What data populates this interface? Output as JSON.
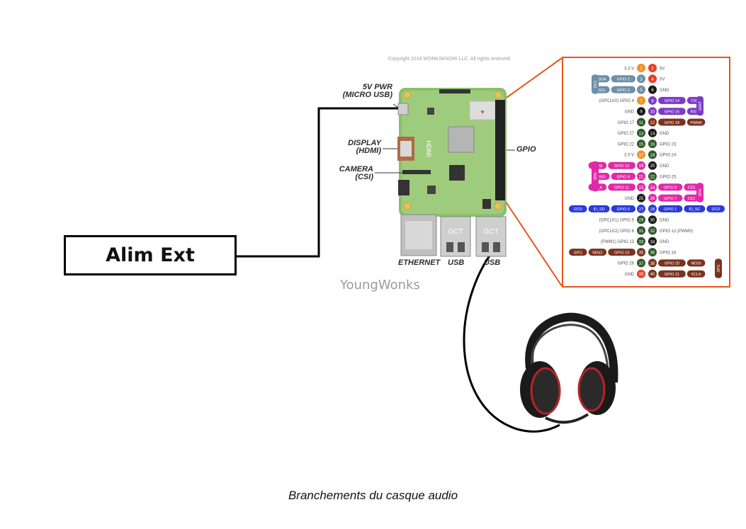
{
  "alim_label": "Alim Ext",
  "caption": "Branchements du casque audio",
  "copyright": "Copyright 2018 WONKSKNOW LLC. All rights reserved.",
  "brand": "YoungWonks",
  "board_labels": {
    "pwr_line1": "5V PWR",
    "pwr_line2": "(MICRO USB)",
    "display_line1": "DISPLAY",
    "display_line2": "(HDMI)",
    "camera_line1": "CAMERA",
    "camera_line2": "(CSI)",
    "gpio": "GPIO",
    "ethernet": "ETHERNET",
    "usb1": "USB",
    "usb2": "USB",
    "hdmi": "HDMI",
    "gct1": "GCT",
    "gct2": "GCT"
  },
  "pin_colors": {
    "power33": "#f0922a",
    "power5": "#e8402a",
    "ground": "#1a1a1a",
    "gpio": "#2f5a2a",
    "i2c": "#6d8fa8",
    "uart": "#7c3bc4",
    "spi": "#e02aa8",
    "pwm": "#7a3320",
    "id": "#2a3adc"
  },
  "pins": [
    {
      "pin_l": "1",
      "pin_r": "2",
      "left_label": "3.3 V",
      "right_label": "5V",
      "left_type": "power33",
      "right_type": "power5",
      "left_tags": [],
      "right_tags": []
    },
    {
      "pin_l": "3",
      "pin_r": "4",
      "left_label": "",
      "right_label": "5V",
      "left_type": "i2c",
      "right_type": "power5",
      "left_tags": [
        {
          "text": "SDA",
          "type": "i2c"
        },
        {
          "text": "GPIO 2",
          "type": "i2c"
        }
      ],
      "right_tags": []
    },
    {
      "pin_l": "5",
      "pin_r": "6",
      "left_label": "",
      "right_label": "GND",
      "left_type": "i2c",
      "right_type": "ground",
      "left_tags": [
        {
          "text": "SCL",
          "type": "i2c"
        },
        {
          "text": "GPIO 3",
          "type": "i2c"
        }
      ],
      "right_tags": []
    },
    {
      "pin_l": "7",
      "pin_r": "8",
      "left_label": "(GPCLK0) GPIO 4",
      "right_label": "",
      "left_type": "power33",
      "right_type": "uart",
      "left_tags": [],
      "right_tags": [
        {
          "text": "GPIO 14",
          "type": "uart"
        },
        {
          "text": "TXD",
          "type": "uart"
        }
      ]
    },
    {
      "pin_l": "9",
      "pin_r": "10",
      "left_label": "GND",
      "right_label": "",
      "left_type": "ground",
      "right_type": "uart",
      "left_tags": [],
      "right_tags": [
        {
          "text": "GPIO 15",
          "type": "uart"
        },
        {
          "text": "RXD",
          "type": "uart"
        }
      ]
    },
    {
      "pin_l": "11",
      "pin_r": "12",
      "left_label": "GPIO 17",
      "right_label": "",
      "left_type": "gpio",
      "right_type": "pwm",
      "left_tags": [],
      "right_tags": [
        {
          "text": "GPIO 18",
          "type": "pwm"
        },
        {
          "text": "PWM0",
          "type": "pwm"
        }
      ]
    },
    {
      "pin_l": "13",
      "pin_r": "14",
      "left_label": "GPIO 27",
      "right_label": "GND",
      "left_type": "gpio",
      "right_type": "ground",
      "left_tags": [],
      "right_tags": []
    },
    {
      "pin_l": "15",
      "pin_r": "16",
      "left_label": "GPIO 22",
      "right_label": "GPIO 23",
      "left_type": "gpio",
      "right_type": "gpio",
      "left_tags": [],
      "right_tags": []
    },
    {
      "pin_l": "17",
      "pin_r": "18",
      "left_label": "3.3 V",
      "right_label": "GPIO 24",
      "left_type": "power33",
      "right_type": "gpio",
      "left_tags": [],
      "right_tags": []
    },
    {
      "pin_l": "19",
      "pin_r": "20",
      "left_label": "",
      "right_label": "GND",
      "left_type": "spi",
      "right_type": "ground",
      "left_tags": [
        {
          "text": "MOSI",
          "type": "spi"
        },
        {
          "text": "GPIO 10",
          "type": "spi"
        }
      ],
      "right_tags": []
    },
    {
      "pin_l": "21",
      "pin_r": "22",
      "left_label": "",
      "right_label": "GPIO 25",
      "left_type": "spi",
      "right_type": "gpio",
      "left_tags": [
        {
          "text": "MISO",
          "type": "spi"
        },
        {
          "text": "GPIO 9",
          "type": "spi"
        }
      ],
      "right_tags": []
    },
    {
      "pin_l": "23",
      "pin_r": "24",
      "left_label": "",
      "right_label": "",
      "left_type": "spi",
      "right_type": "spi",
      "left_tags": [
        {
          "text": "SCLK",
          "type": "spi"
        },
        {
          "text": "GPIO 11",
          "type": "spi"
        }
      ],
      "right_tags": [
        {
          "text": "GPIO 8",
          "type": "spi"
        },
        {
          "text": "CE0",
          "type": "spi"
        }
      ]
    },
    {
      "pin_l": "25",
      "pin_r": "26",
      "left_label": "GND",
      "right_label": "",
      "left_type": "ground",
      "right_type": "spi",
      "left_tags": [],
      "right_tags": [
        {
          "text": "GPIO 7",
          "type": "spi"
        },
        {
          "text": "CE1",
          "type": "spi"
        }
      ]
    },
    {
      "pin_l": "27",
      "pin_r": "28",
      "left_label": "",
      "right_label": "",
      "left_type": "id",
      "right_type": "id",
      "left_tags": [
        {
          "text": "I2C0",
          "type": "id"
        },
        {
          "text": "ID_SD",
          "type": "id"
        },
        {
          "text": "GPIO 0",
          "type": "id"
        }
      ],
      "right_tags": [
        {
          "text": "GPIO 1",
          "type": "id"
        },
        {
          "text": "ID_SC",
          "type": "id"
        },
        {
          "text": "I2C0",
          "type": "id"
        }
      ]
    },
    {
      "pin_l": "29",
      "pin_r": "30",
      "left_label": "(GPCLK1) GPIO 5",
      "right_label": "GND",
      "left_type": "gpio",
      "right_type": "ground",
      "left_tags": [],
      "right_tags": []
    },
    {
      "pin_l": "31",
      "pin_r": "32",
      "left_label": "(GPCLK2) GPIO 6",
      "right_label": "GPIO 12 (PWM0)",
      "left_type": "gpio",
      "right_type": "gpio",
      "left_tags": [],
      "right_tags": []
    },
    {
      "pin_l": "33",
      "pin_r": "34",
      "left_label": "(PWM1) GPIO 13",
      "right_label": "GND",
      "left_type": "gpio",
      "right_type": "ground",
      "left_tags": [],
      "right_tags": []
    },
    {
      "pin_l": "35",
      "pin_r": "36",
      "left_label": "",
      "right_label": "GPIO 16",
      "left_type": "pwm",
      "right_type": "gpio",
      "left_tags": [
        {
          "text": "SPI1",
          "type": "pwm"
        },
        {
          "text": "MISO",
          "type": "pwm"
        },
        {
          "text": "GPIO 19",
          "type": "pwm"
        }
      ],
      "right_tags": []
    },
    {
      "pin_l": "37",
      "pin_r": "38",
      "left_label": "GPIO 26",
      "right_label": "",
      "left_type": "gpio",
      "right_type": "pwm",
      "left_tags": [],
      "right_tags": [
        {
          "text": "GPIO 20",
          "type": "pwm"
        },
        {
          "text": "MOSI",
          "type": "pwm"
        }
      ]
    },
    {
      "pin_l": "39",
      "pin_r": "40",
      "left_label": "GND",
      "right_label": "",
      "left_type": "power5",
      "right_type": "pwm",
      "left_tags": [],
      "right_tags": [
        {
          "text": "GPIO 21",
          "type": "pwm"
        },
        {
          "text": "SCLK",
          "type": "pwm"
        }
      ]
    }
  ],
  "side_brackets": {
    "i2c1": "I2C1",
    "uart": "UART",
    "spi0_left": "SPI0",
    "spi0_right": "SPI0",
    "spi1": "SPI1"
  }
}
